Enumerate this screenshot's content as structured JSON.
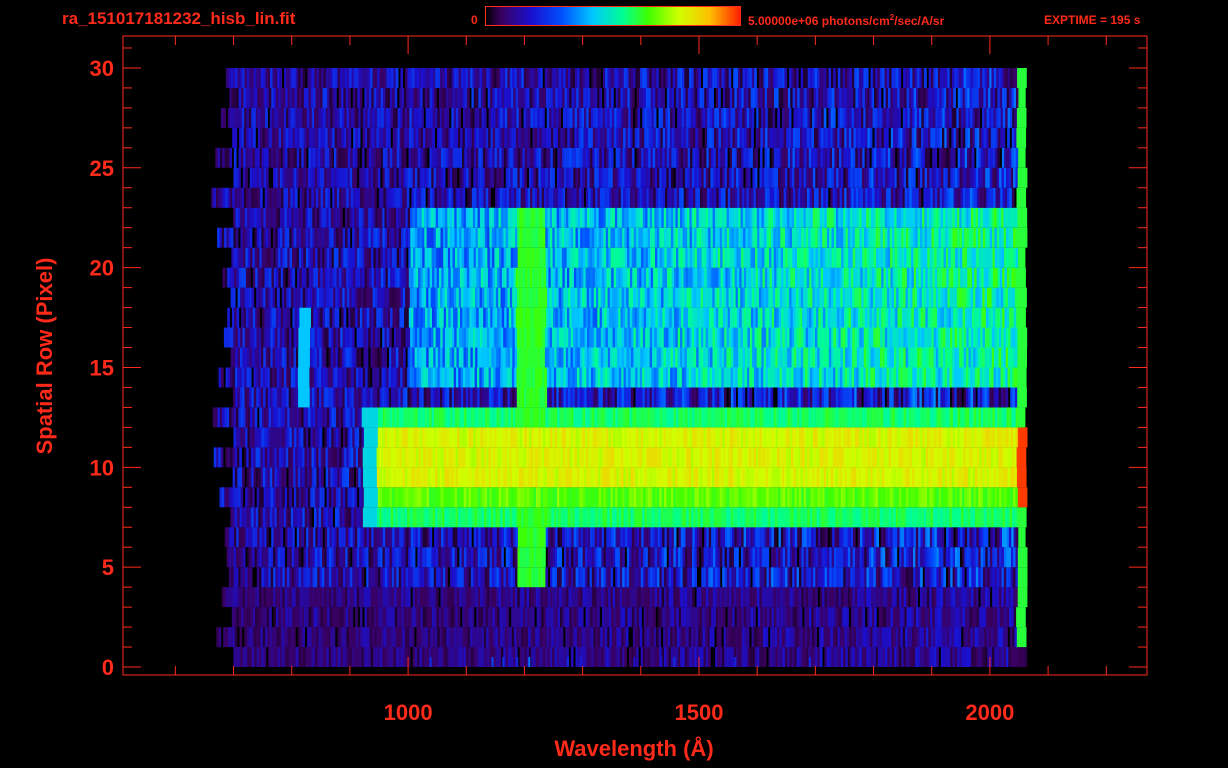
{
  "header": {
    "filename": "ra_151017181232_hisb_lin.fit",
    "colorbar_min": "0",
    "colorbar_max": "5.00000e+06",
    "colorbar_unit_pre": " photons/cm",
    "colorbar_unit_sup": "2",
    "colorbar_unit_post": "/sec/A/sr",
    "exptime": "EXPTIME = 195 s"
  },
  "colors": {
    "axis": "#ff2a1a",
    "background": "#000000"
  },
  "chart_data": {
    "type": "heatmap",
    "title": "ra_151017181232_hisb_lin.fit",
    "xlabel": "Wavelength (Å)",
    "ylabel": "Spatial Row (Pixel)",
    "xlim": [
      510,
      2270
    ],
    "ylim": [
      -0.4,
      31.6
    ],
    "x_ticks": [
      1000,
      1500,
      2000
    ],
    "y_ticks": [
      0,
      5,
      10,
      15,
      20,
      25,
      30
    ],
    "x_tick_labels": [
      "1000",
      "1500",
      "2000"
    ],
    "y_tick_labels": [
      "0",
      "5",
      "10",
      "15",
      "20",
      "25",
      "30"
    ],
    "colorbar": {
      "min": 0,
      "max": 5000000,
      "unit": "photons/cm^2/sec/A/sr",
      "colormap": "rainbow"
    },
    "exptime_s": 195,
    "rows": 30,
    "wavelength_range": [
      690,
      2060
    ],
    "features": [
      {
        "label": "bright continuum band",
        "rows": [
          8,
          13
        ],
        "wavelength": [
          920,
          2060
        ],
        "level": "high"
      },
      {
        "label": "emission line",
        "rows": [
          5,
          23
        ],
        "wavelength": [
          1185,
          1235
        ],
        "level": "high"
      },
      {
        "label": "emission line",
        "rows": [
          14,
          18
        ],
        "wavelength": [
          810,
          830
        ],
        "level": "medium"
      },
      {
        "label": "detector edge",
        "rows": [
          2,
          30
        ],
        "wavelength": [
          2045,
          2065
        ],
        "level": "high"
      }
    ],
    "grid": false,
    "legend": "colorbar top"
  }
}
